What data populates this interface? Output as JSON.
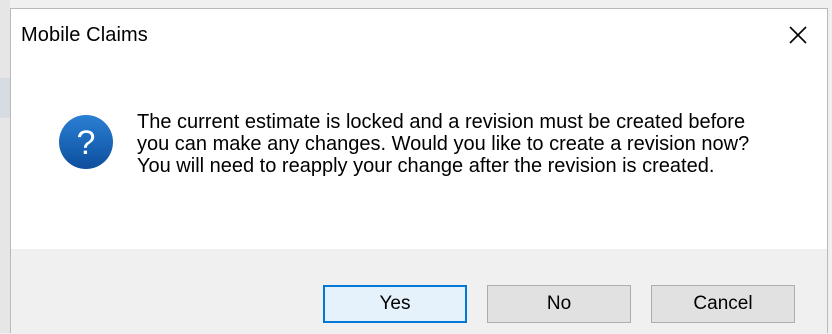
{
  "dialog": {
    "title": "Mobile Claims",
    "close_icon": "close-icon",
    "message_icon": "question-icon",
    "message": "The current estimate is locked and a revision must be created before you can make any changes. Would you like to create a revision now? You will need to reapply your change after the revision is created.",
    "buttons": {
      "yes": "Yes",
      "no": "No",
      "cancel": "Cancel"
    },
    "default_button": "yes"
  },
  "colors": {
    "accent": "#0078d7",
    "icon_blue": "#1565c0",
    "footer_bg": "#f0f0f0"
  }
}
